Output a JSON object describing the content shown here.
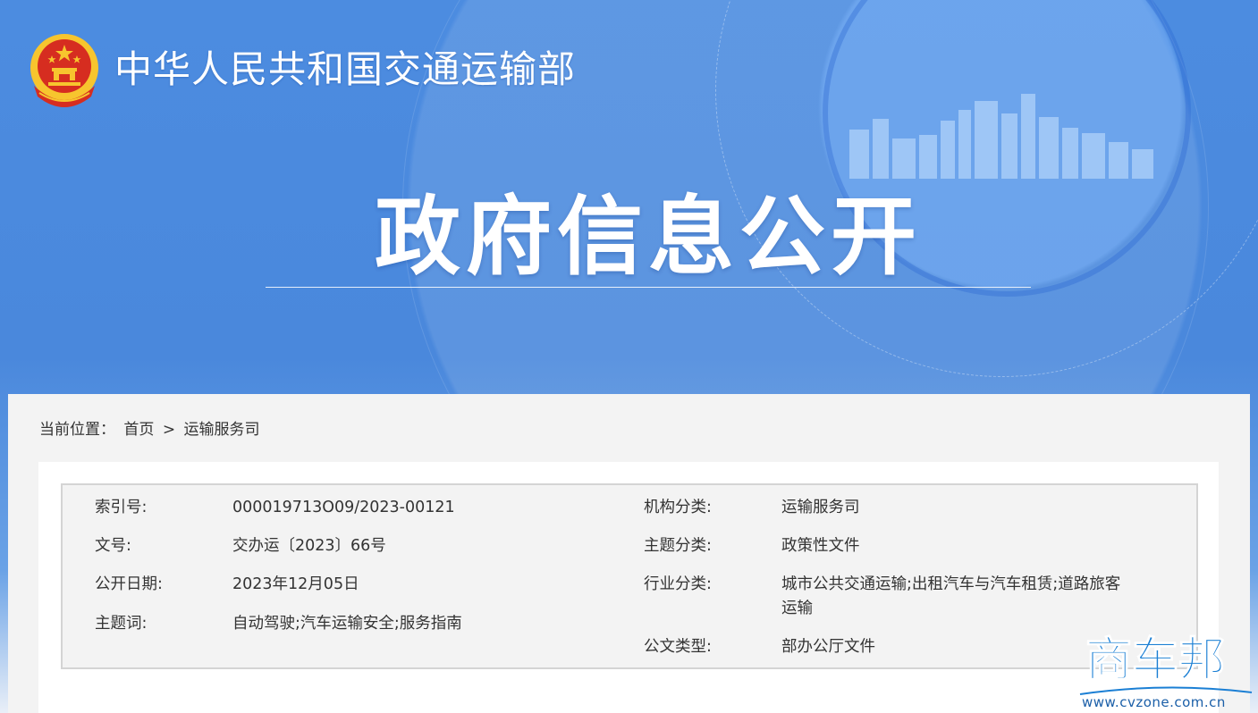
{
  "header": {
    "org_name": "中华人民共和国交通运输部",
    "banner_title": "政府信息公开"
  },
  "breadcrumb": {
    "prefix": "当前位置：",
    "items": [
      "首页",
      "运输服务司"
    ],
    "separator": ">"
  },
  "metadata": {
    "left": [
      {
        "label": "索引号:",
        "value": "000019713O09/2023-00121"
      },
      {
        "label": "文号:",
        "value": "交办运〔2023〕66号"
      },
      {
        "label": "公开日期:",
        "value": "2023年12月05日"
      },
      {
        "label": "主题词:",
        "value": "自动驾驶;汽车运输安全;服务指南"
      }
    ],
    "right": [
      {
        "label": "机构分类:",
        "value": "运输服务司"
      },
      {
        "label": "主题分类:",
        "value": "政策性文件"
      },
      {
        "label": "行业分类:",
        "value_line1": "城市公共交通运输;出租汽车与汽车租赁;道路旅客",
        "value_line2": "运输"
      },
      {
        "label": "公文类型:",
        "value": "部办公厅文件"
      }
    ]
  },
  "watermark": {
    "text": "商车邦",
    "url": "www.cvzone.com.cn"
  },
  "colors": {
    "banner_blue": "#4a88dc",
    "emblem_red": "#d62d20",
    "emblem_gold": "#f7c52e",
    "watermark_blue": "#1b7fd4"
  }
}
